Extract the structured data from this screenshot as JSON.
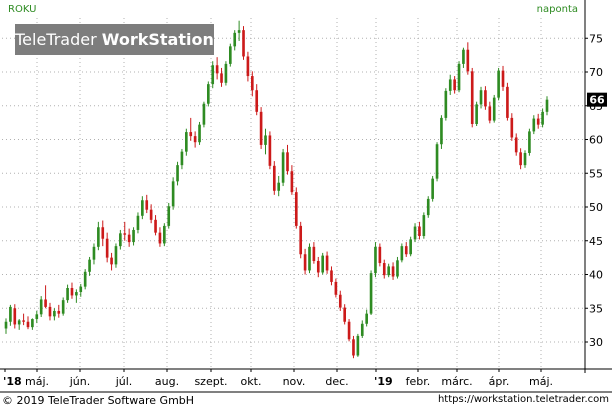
{
  "header": {
    "symbol": "ROKU",
    "interval": "naponta"
  },
  "watermark": {
    "brand_regular": "TeleTrader",
    "brand_bold": "WorkStation"
  },
  "footer": {
    "copyright": "© 2019 TeleTrader Software GmbH",
    "url": "https://workstation.teletrader.com"
  },
  "colors": {
    "up": "#2e8b22",
    "down": "#cc1a1a",
    "grid": "#b0b0b0",
    "axis": "#000000",
    "accent_text": "#2e8b22",
    "watermark_bg": "#7d7d7d"
  },
  "chart_data": {
    "type": "candlestick",
    "title": "",
    "xlabel": "",
    "ylabel": "",
    "ylim": [
      26,
      78
    ],
    "y_ticks": [
      30,
      35,
      40,
      45,
      50,
      55,
      60,
      65,
      70,
      75
    ],
    "last_value_label": "66",
    "x_tick_labels": [
      "'18",
      "máj.",
      "jún.",
      "júl.",
      "aug.",
      "szept.",
      "okt.",
      "nov.",
      "dec.",
      "'19",
      "febr.",
      "márc.",
      "ápr.",
      "máj."
    ],
    "grid": true,
    "legend": "none",
    "candles": [
      [
        32.0,
        33.5,
        31.2,
        33.0
      ],
      [
        33.0,
        35.5,
        32.4,
        35.2
      ],
      [
        35.0,
        35.6,
        32.0,
        32.6
      ],
      [
        32.6,
        33.4,
        31.8,
        33.2
      ],
      [
        33.2,
        34.2,
        32.5,
        33.0
      ],
      [
        33.0,
        33.8,
        31.9,
        32.2
      ],
      [
        32.2,
        33.5,
        31.8,
        33.4
      ],
      [
        33.4,
        34.6,
        32.8,
        34.1
      ],
      [
        34.1,
        36.8,
        33.7,
        36.3
      ],
      [
        36.3,
        38.4,
        35.0,
        35.2
      ],
      [
        35.2,
        35.8,
        33.2,
        33.8
      ],
      [
        33.8,
        35.0,
        33.2,
        34.6
      ],
      [
        34.6,
        35.5,
        33.6,
        34.2
      ],
      [
        34.2,
        36.6,
        33.9,
        36.2
      ],
      [
        36.2,
        38.5,
        35.8,
        38.0
      ],
      [
        38.0,
        38.8,
        36.4,
        36.9
      ],
      [
        36.9,
        37.8,
        35.8,
        37.4
      ],
      [
        37.4,
        38.6,
        36.7,
        38.2
      ],
      [
        38.2,
        40.8,
        37.8,
        40.4
      ],
      [
        40.4,
        42.6,
        39.8,
        42.2
      ],
      [
        42.2,
        44.6,
        41.5,
        44.1
      ],
      [
        44.1,
        47.8,
        43.6,
        47.0
      ],
      [
        47.0,
        48.0,
        44.2,
        45.3
      ],
      [
        45.3,
        46.2,
        41.8,
        42.5
      ],
      [
        42.5,
        43.2,
        40.6,
        41.5
      ],
      [
        41.5,
        44.6,
        41.0,
        44.2
      ],
      [
        44.2,
        46.6,
        43.7,
        46.1
      ],
      [
        46.1,
        47.8,
        45.0,
        45.9
      ],
      [
        45.9,
        46.8,
        44.1,
        44.8
      ],
      [
        44.8,
        47.0,
        44.3,
        46.6
      ],
      [
        46.6,
        49.2,
        46.1,
        48.7
      ],
      [
        48.7,
        51.6,
        48.2,
        51.0
      ],
      [
        51.0,
        51.8,
        49.1,
        49.6
      ],
      [
        49.6,
        50.4,
        47.6,
        48.1
      ],
      [
        48.1,
        48.8,
        45.8,
        46.2
      ],
      [
        46.2,
        47.0,
        44.1,
        44.6
      ],
      [
        44.6,
        47.6,
        44.2,
        47.2
      ],
      [
        47.2,
        50.6,
        46.8,
        50.1
      ],
      [
        50.1,
        54.4,
        49.6,
        53.8
      ],
      [
        53.8,
        56.7,
        53.2,
        56.2
      ],
      [
        56.2,
        58.6,
        55.6,
        58.2
      ],
      [
        58.2,
        61.6,
        57.6,
        61.1
      ],
      [
        61.1,
        63.2,
        59.8,
        60.5
      ],
      [
        60.5,
        61.2,
        58.8,
        59.6
      ],
      [
        59.6,
        62.6,
        59.2,
        62.2
      ],
      [
        62.2,
        65.6,
        61.8,
        65.3
      ],
      [
        65.3,
        68.6,
        64.9,
        68.2
      ],
      [
        68.2,
        71.6,
        67.6,
        71.0
      ],
      [
        71.0,
        72.2,
        68.9,
        69.8
      ],
      [
        69.8,
        70.6,
        67.8,
        68.4
      ],
      [
        68.4,
        71.6,
        68.0,
        71.2
      ],
      [
        71.2,
        74.2,
        70.8,
        73.8
      ],
      [
        73.8,
        76.2,
        73.2,
        75.8
      ],
      [
        75.8,
        77.6,
        74.6,
        76.2
      ],
      [
        76.2,
        76.8,
        71.8,
        72.3
      ],
      [
        72.3,
        73.0,
        68.6,
        69.4
      ],
      [
        69.4,
        70.1,
        66.4,
        67.3
      ],
      [
        67.3,
        68.2,
        63.6,
        64.1
      ],
      [
        64.1,
        64.8,
        58.6,
        59.2
      ],
      [
        59.2,
        61.6,
        57.8,
        60.6
      ],
      [
        60.6,
        61.2,
        55.6,
        56.1
      ],
      [
        56.1,
        56.8,
        51.8,
        52.4
      ],
      [
        52.4,
        54.6,
        51.6,
        53.6
      ],
      [
        53.6,
        58.6,
        53.1,
        58.1
      ],
      [
        58.1,
        59.2,
        54.8,
        55.3
      ],
      [
        55.3,
        56.2,
        51.8,
        52.2
      ],
      [
        52.2,
        52.9,
        46.8,
        47.2
      ],
      [
        47.2,
        47.8,
        42.4,
        43.0
      ],
      [
        43.0,
        43.8,
        40.0,
        40.6
      ],
      [
        40.6,
        44.6,
        40.2,
        44.1
      ],
      [
        44.1,
        44.8,
        41.6,
        42.0
      ],
      [
        42.0,
        42.6,
        39.6,
        40.3
      ],
      [
        40.3,
        43.2,
        40.0,
        42.8
      ],
      [
        42.8,
        43.4,
        40.1,
        40.6
      ],
      [
        40.6,
        41.2,
        38.4,
        38.9
      ],
      [
        38.9,
        39.4,
        36.6,
        37.0
      ],
      [
        37.0,
        37.6,
        34.6,
        35.1
      ],
      [
        35.1,
        35.6,
        32.6,
        33.0
      ],
      [
        33.0,
        33.4,
        30.1,
        30.4
      ],
      [
        30.4,
        30.9,
        27.6,
        28.0
      ],
      [
        28.0,
        31.2,
        27.8,
        30.9
      ],
      [
        30.9,
        33.2,
        30.6,
        32.7
      ],
      [
        32.7,
        34.8,
        32.3,
        34.2
      ],
      [
        34.2,
        40.6,
        34.0,
        40.2
      ],
      [
        40.2,
        44.8,
        39.6,
        44.1
      ],
      [
        44.1,
        44.6,
        41.2,
        41.7
      ],
      [
        41.7,
        42.2,
        39.4,
        39.9
      ],
      [
        39.9,
        41.6,
        39.6,
        41.2
      ],
      [
        41.2,
        41.8,
        39.2,
        39.7
      ],
      [
        39.7,
        42.6,
        39.4,
        42.1
      ],
      [
        42.1,
        44.6,
        41.8,
        44.2
      ],
      [
        44.2,
        44.8,
        42.6,
        43.0
      ],
      [
        43.0,
        45.6,
        42.7,
        45.2
      ],
      [
        45.2,
        47.6,
        44.8,
        47.1
      ],
      [
        47.1,
        47.8,
        45.2,
        45.7
      ],
      [
        45.7,
        49.2,
        45.3,
        48.8
      ],
      [
        48.8,
        51.6,
        48.4,
        51.2
      ],
      [
        51.2,
        54.6,
        50.8,
        54.2
      ],
      [
        54.2,
        59.6,
        53.8,
        59.3
      ],
      [
        59.3,
        63.6,
        58.6,
        63.2
      ],
      [
        63.2,
        67.6,
        62.8,
        67.2
      ],
      [
        67.2,
        69.6,
        66.6,
        68.9
      ],
      [
        68.9,
        69.4,
        66.8,
        67.3
      ],
      [
        67.3,
        71.6,
        67.0,
        71.2
      ],
      [
        71.2,
        73.6,
        70.6,
        73.3
      ],
      [
        73.3,
        74.4,
        69.6,
        70.1
      ],
      [
        70.1,
        70.6,
        61.8,
        62.3
      ],
      [
        62.3,
        65.6,
        62.0,
        65.2
      ],
      [
        65.2,
        67.8,
        64.6,
        67.3
      ],
      [
        67.3,
        67.9,
        64.4,
        64.9
      ],
      [
        64.9,
        65.6,
        62.4,
        62.8
      ],
      [
        62.8,
        66.6,
        62.5,
        66.2
      ],
      [
        66.2,
        70.6,
        65.8,
        70.2
      ],
      [
        70.2,
        70.9,
        67.2,
        67.8
      ],
      [
        67.8,
        68.4,
        62.8,
        63.2
      ],
      [
        63.2,
        63.9,
        59.8,
        60.3
      ],
      [
        60.3,
        60.9,
        57.6,
        58.1
      ],
      [
        58.1,
        58.7,
        55.6,
        56.2
      ],
      [
        56.2,
        58.4,
        55.8,
        58.0
      ],
      [
        58.0,
        61.6,
        57.6,
        61.2
      ],
      [
        61.2,
        63.6,
        60.8,
        63.1
      ],
      [
        63.1,
        63.8,
        61.6,
        62.2
      ],
      [
        62.2,
        64.6,
        61.8,
        64.1
      ],
      [
        64.1,
        66.4,
        63.6,
        65.9
      ]
    ]
  }
}
